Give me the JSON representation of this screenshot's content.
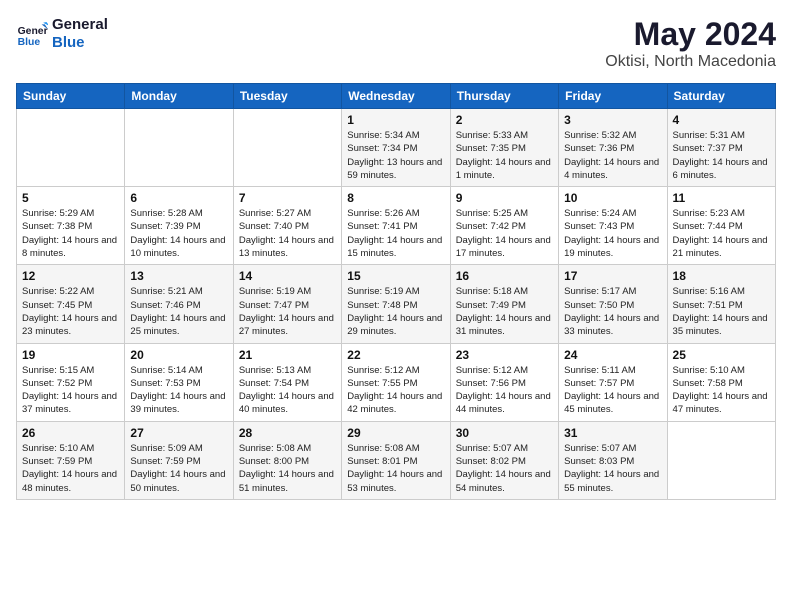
{
  "header": {
    "logo_line1": "General",
    "logo_line2": "Blue",
    "title": "May 2024",
    "subtitle": "Oktisi, North Macedonia"
  },
  "weekdays": [
    "Sunday",
    "Monday",
    "Tuesday",
    "Wednesday",
    "Thursday",
    "Friday",
    "Saturday"
  ],
  "weeks": [
    [
      {
        "day": "",
        "info": ""
      },
      {
        "day": "",
        "info": ""
      },
      {
        "day": "",
        "info": ""
      },
      {
        "day": "1",
        "info": "Sunrise: 5:34 AM\nSunset: 7:34 PM\nDaylight: 13 hours and 59 minutes."
      },
      {
        "day": "2",
        "info": "Sunrise: 5:33 AM\nSunset: 7:35 PM\nDaylight: 14 hours and 1 minute."
      },
      {
        "day": "3",
        "info": "Sunrise: 5:32 AM\nSunset: 7:36 PM\nDaylight: 14 hours and 4 minutes."
      },
      {
        "day": "4",
        "info": "Sunrise: 5:31 AM\nSunset: 7:37 PM\nDaylight: 14 hours and 6 minutes."
      }
    ],
    [
      {
        "day": "5",
        "info": "Sunrise: 5:29 AM\nSunset: 7:38 PM\nDaylight: 14 hours and 8 minutes."
      },
      {
        "day": "6",
        "info": "Sunrise: 5:28 AM\nSunset: 7:39 PM\nDaylight: 14 hours and 10 minutes."
      },
      {
        "day": "7",
        "info": "Sunrise: 5:27 AM\nSunset: 7:40 PM\nDaylight: 14 hours and 13 minutes."
      },
      {
        "day": "8",
        "info": "Sunrise: 5:26 AM\nSunset: 7:41 PM\nDaylight: 14 hours and 15 minutes."
      },
      {
        "day": "9",
        "info": "Sunrise: 5:25 AM\nSunset: 7:42 PM\nDaylight: 14 hours and 17 minutes."
      },
      {
        "day": "10",
        "info": "Sunrise: 5:24 AM\nSunset: 7:43 PM\nDaylight: 14 hours and 19 minutes."
      },
      {
        "day": "11",
        "info": "Sunrise: 5:23 AM\nSunset: 7:44 PM\nDaylight: 14 hours and 21 minutes."
      }
    ],
    [
      {
        "day": "12",
        "info": "Sunrise: 5:22 AM\nSunset: 7:45 PM\nDaylight: 14 hours and 23 minutes."
      },
      {
        "day": "13",
        "info": "Sunrise: 5:21 AM\nSunset: 7:46 PM\nDaylight: 14 hours and 25 minutes."
      },
      {
        "day": "14",
        "info": "Sunrise: 5:19 AM\nSunset: 7:47 PM\nDaylight: 14 hours and 27 minutes."
      },
      {
        "day": "15",
        "info": "Sunrise: 5:19 AM\nSunset: 7:48 PM\nDaylight: 14 hours and 29 minutes."
      },
      {
        "day": "16",
        "info": "Sunrise: 5:18 AM\nSunset: 7:49 PM\nDaylight: 14 hours and 31 minutes."
      },
      {
        "day": "17",
        "info": "Sunrise: 5:17 AM\nSunset: 7:50 PM\nDaylight: 14 hours and 33 minutes."
      },
      {
        "day": "18",
        "info": "Sunrise: 5:16 AM\nSunset: 7:51 PM\nDaylight: 14 hours and 35 minutes."
      }
    ],
    [
      {
        "day": "19",
        "info": "Sunrise: 5:15 AM\nSunset: 7:52 PM\nDaylight: 14 hours and 37 minutes."
      },
      {
        "day": "20",
        "info": "Sunrise: 5:14 AM\nSunset: 7:53 PM\nDaylight: 14 hours and 39 minutes."
      },
      {
        "day": "21",
        "info": "Sunrise: 5:13 AM\nSunset: 7:54 PM\nDaylight: 14 hours and 40 minutes."
      },
      {
        "day": "22",
        "info": "Sunrise: 5:12 AM\nSunset: 7:55 PM\nDaylight: 14 hours and 42 minutes."
      },
      {
        "day": "23",
        "info": "Sunrise: 5:12 AM\nSunset: 7:56 PM\nDaylight: 14 hours and 44 minutes."
      },
      {
        "day": "24",
        "info": "Sunrise: 5:11 AM\nSunset: 7:57 PM\nDaylight: 14 hours and 45 minutes."
      },
      {
        "day": "25",
        "info": "Sunrise: 5:10 AM\nSunset: 7:58 PM\nDaylight: 14 hours and 47 minutes."
      }
    ],
    [
      {
        "day": "26",
        "info": "Sunrise: 5:10 AM\nSunset: 7:59 PM\nDaylight: 14 hours and 48 minutes."
      },
      {
        "day": "27",
        "info": "Sunrise: 5:09 AM\nSunset: 7:59 PM\nDaylight: 14 hours and 50 minutes."
      },
      {
        "day": "28",
        "info": "Sunrise: 5:08 AM\nSunset: 8:00 PM\nDaylight: 14 hours and 51 minutes."
      },
      {
        "day": "29",
        "info": "Sunrise: 5:08 AM\nSunset: 8:01 PM\nDaylight: 14 hours and 53 minutes."
      },
      {
        "day": "30",
        "info": "Sunrise: 5:07 AM\nSunset: 8:02 PM\nDaylight: 14 hours and 54 minutes."
      },
      {
        "day": "31",
        "info": "Sunrise: 5:07 AM\nSunset: 8:03 PM\nDaylight: 14 hours and 55 minutes."
      },
      {
        "day": "",
        "info": ""
      }
    ]
  ]
}
